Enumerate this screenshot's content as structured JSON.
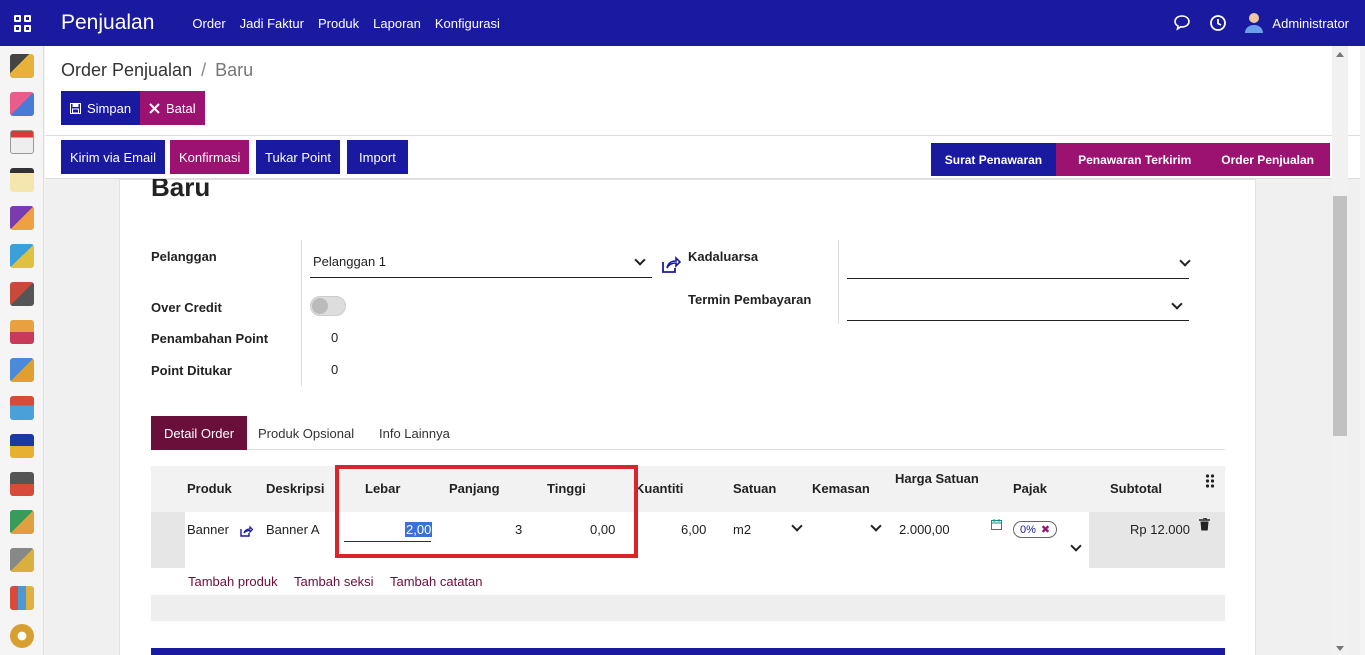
{
  "topbar": {
    "app_title": "Penjualan",
    "menu": [
      "Order",
      "Jadi Faktur",
      "Produk",
      "Laporan",
      "Konfigurasi"
    ],
    "user": "Administrator"
  },
  "breadcrumb": {
    "parent": "Order Penjualan",
    "separator": "/",
    "current": "Baru"
  },
  "buttons": {
    "save": "Simpan",
    "discard": "Batal",
    "send_email": "Kirim via Email",
    "confirm": "Konfirmasi",
    "redeem_point": "Tukar Point",
    "import": "Import"
  },
  "stages": [
    "Surat Penawaran",
    "Penawaran Terkirim",
    "Order Penjualan"
  ],
  "form": {
    "title": "Baru",
    "customer_label": "Pelanggan",
    "customer_value": "Pelanggan 1",
    "over_credit_label": "Over Credit",
    "added_point_label": "Penambahan Point",
    "added_point_value": "0",
    "redeemed_point_label": "Point Ditukar",
    "redeemed_point_value": "0",
    "expiry_label": "Kadaluarsa",
    "payment_terms_label": "Termin Pembayaran"
  },
  "tabs": [
    "Detail Order",
    "Produk Opsional",
    "Info Lainnya"
  ],
  "table": {
    "headers": [
      "Produk",
      "Deskripsi",
      "Lebar",
      "Panjang",
      "Tinggi",
      "Kuantiti",
      "Satuan",
      "Kemasan",
      "Harga Satuan",
      "Pajak",
      "Subtotal"
    ],
    "row": {
      "product": "Banner",
      "description": "Banner A",
      "width": "2,00",
      "length": "3",
      "height": "0,00",
      "quantity": "6,00",
      "unit": "m2",
      "unit_price": "2.000,00",
      "tax": "0%",
      "subtotal": "Rp 12.000"
    },
    "add_links": [
      "Tambah produk",
      "Tambah seksi",
      "Tambah catatan"
    ]
  },
  "colors": {
    "primary": "#1a1aa0",
    "secondary": "#9c1270",
    "tab_active": "#6a0f3a",
    "highlight": "#d9242b"
  }
}
